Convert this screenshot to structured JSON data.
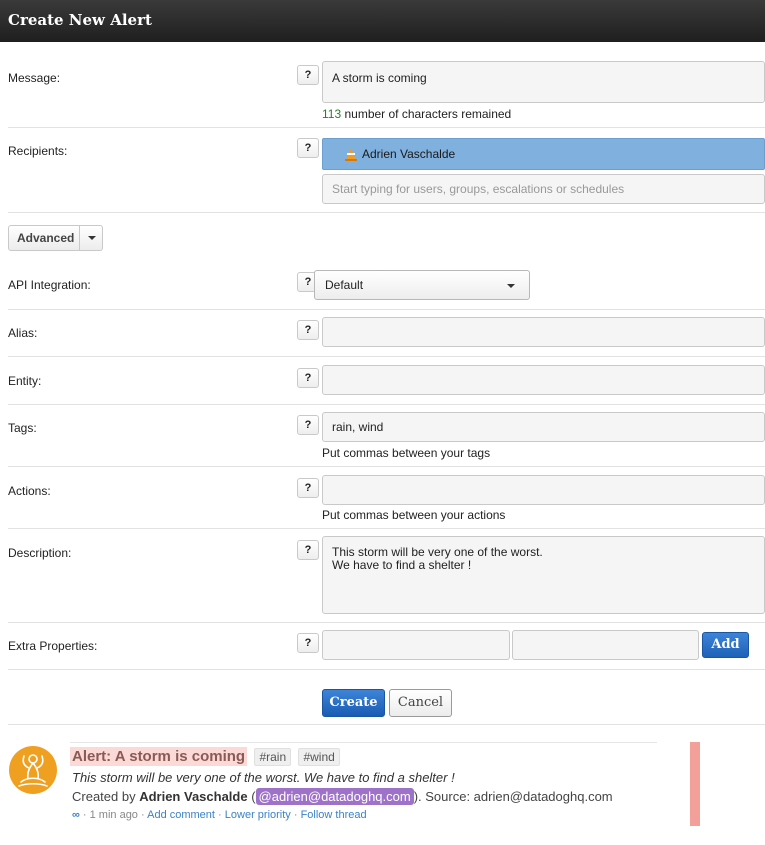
{
  "header": {
    "title": "Create New Alert"
  },
  "form": {
    "help_glyph": "?",
    "message": {
      "label": "Message:",
      "value": "A storm is coming",
      "remaining_count": "113",
      "remaining_text": " number of characters remained"
    },
    "recipients": {
      "label": "Recipients:",
      "selected_name": "Adrien Vaschalde",
      "placeholder": "Start typing for users, groups, escalations or schedules"
    },
    "advanced": {
      "label": "Advanced"
    },
    "api_integration": {
      "label": "API Integration:",
      "value": "Default"
    },
    "alias": {
      "label": "Alias:",
      "value": ""
    },
    "entity": {
      "label": "Entity:",
      "value": ""
    },
    "tags": {
      "label": "Tags:",
      "value": "rain, wind",
      "hint": "Put commas between your tags"
    },
    "actions": {
      "label": "Actions:",
      "value": "",
      "hint": "Put commas between your actions"
    },
    "description": {
      "label": "Description:",
      "line1": "This storm will be very one of the worst.",
      "line2": "We have to find a shelter !"
    },
    "extra_properties": {
      "label": "Extra Properties:",
      "key": "",
      "value": "",
      "add_label": "Add"
    },
    "buttons": {
      "create": "Create",
      "cancel": "Cancel"
    }
  },
  "feed_item": {
    "title": "Alert: A storm is coming",
    "tags": [
      "#rain",
      "#wind"
    ],
    "description": "This storm will be very one of the worst. We have to find a shelter !",
    "created_by_prefix": "Created by ",
    "author": "Adrien Vaschalde",
    "open_paren": " (",
    "mention": "@adrien@datadoghq.com",
    "source_text": "). Source: adrien@datadoghq.com",
    "infinity": "∞",
    "time": " · 1 min ago · ",
    "add_comment": "Add comment",
    "sep": " · ",
    "lower_priority": "Lower priority",
    "follow_thread": "Follow thread"
  },
  "colors": {
    "accent_blue": "#1f62b8",
    "chip_blue": "#7fb0de",
    "alert_pink": "#fbd9d6",
    "mention_purple": "#9e72c9",
    "avatar_orange": "#f0a021"
  }
}
